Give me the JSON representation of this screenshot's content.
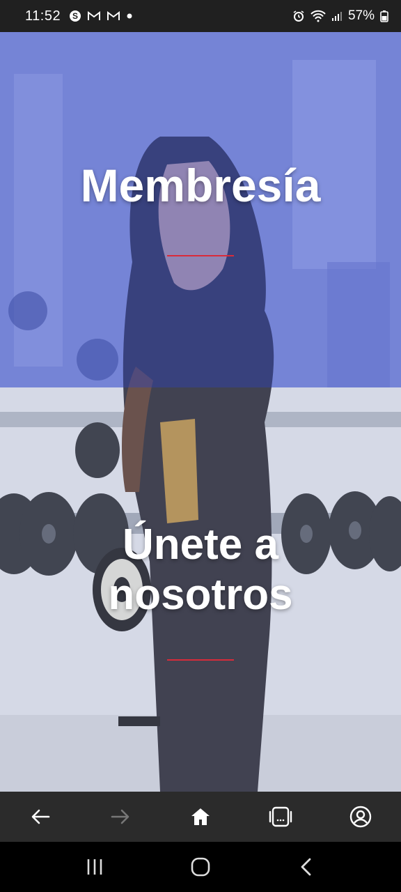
{
  "status_bar": {
    "time": "11:52",
    "battery": "57%",
    "left_icons": [
      "skype-icon",
      "gmail-icon",
      "gmail-icon",
      "notification-dot-icon"
    ],
    "right_icons": [
      "alarm-icon",
      "wifi-icon",
      "signal-icon",
      "battery-icon"
    ]
  },
  "hero": {
    "membresia_title": "Membresía",
    "unete_line1": "Únete a",
    "unete_line2": "nosotros",
    "accent_color": "#d92b3a",
    "overlay_color": "#5064dc"
  },
  "toolbar": {
    "icons": [
      "back-arrow-icon",
      "forward-arrow-icon",
      "home-icon",
      "tabs-icon",
      "account-icon"
    ]
  },
  "navbar": {
    "icons": [
      "recents-icon",
      "home-circle-icon",
      "back-chevron-icon"
    ]
  }
}
